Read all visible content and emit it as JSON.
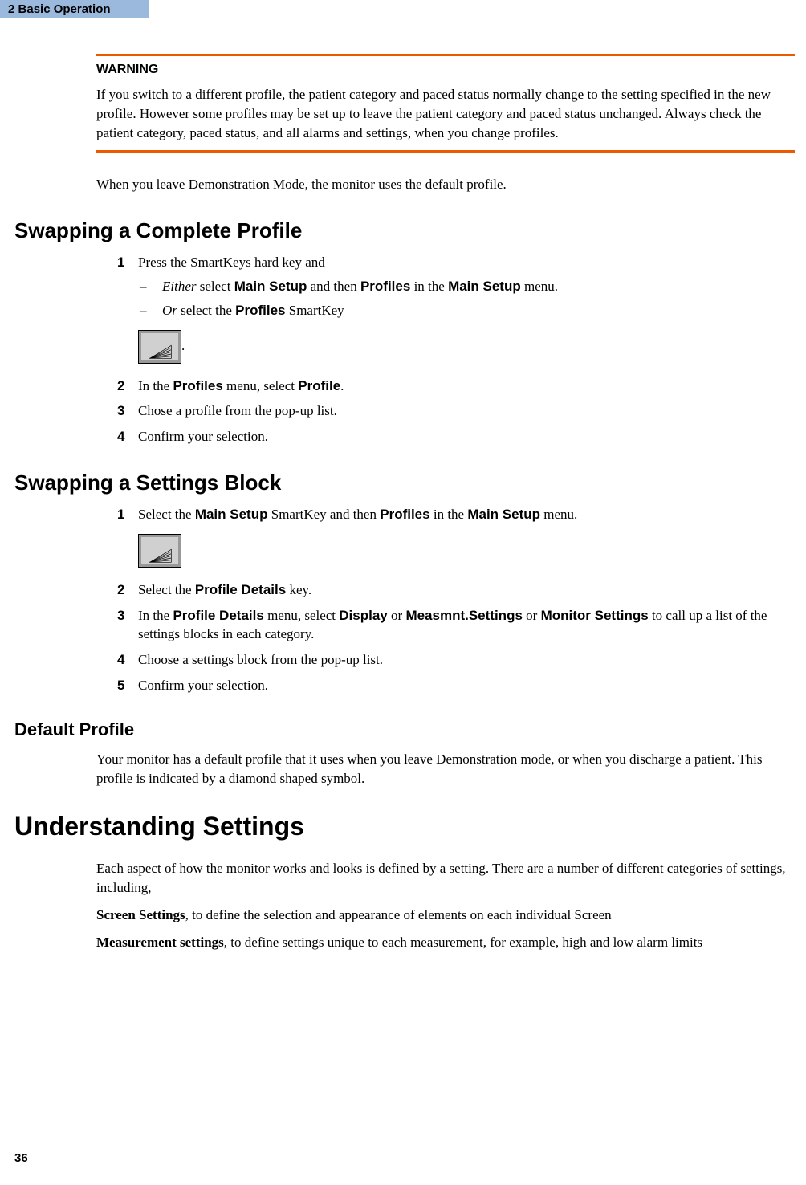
{
  "header": {
    "chapter_number": "2",
    "chapter_title": "Basic Operation"
  },
  "warning": {
    "label": "WARNING",
    "text": "If you switch to a different profile, the patient category and paced status normally change to the setting specified in the new profile. However some profiles may be set up to leave the patient category and paced status unchanged. Always check the patient category, paced status, and all alarms and settings, when you change profiles."
  },
  "demo_text": "When you leave Demonstration Mode, the monitor uses the default profile.",
  "swap_complete": {
    "title": "Swapping a Complete Profile",
    "step1_intro": "Press the SmartKeys hard key and",
    "step1_either_pre": "Either",
    "step1_either_1": " select ",
    "step1_either_ui1": "Main Setup",
    "step1_either_2": " and then ",
    "step1_either_ui2": "Profiles",
    "step1_either_3": " in the ",
    "step1_either_ui3": "Main Setup",
    "step1_either_4": " menu.",
    "step1_or_pre": "Or",
    "step1_or_1": " select the ",
    "step1_or_ui1": "Profiles",
    "step1_or_2": " SmartKey",
    "step1_period": ".",
    "step2_1": "In the ",
    "step2_ui1": "Profiles",
    "step2_2": " menu, select ",
    "step2_ui2": "Profile",
    "step2_3": ".",
    "step3": "Chose a profile from the pop-up list.",
    "step4": "Confirm your selection."
  },
  "swap_block": {
    "title": "Swapping a Settings Block",
    "step1_1": "Select the ",
    "step1_ui1": "Main Setup",
    "step1_2": " SmartKey and then ",
    "step1_ui2": "Profiles",
    "step1_3": " in the ",
    "step1_ui3": "Main Setup",
    "step1_4": " menu.",
    "step2_1": "Select the ",
    "step2_ui1": "Profile Details",
    "step2_2": " key.",
    "step3_1": "In the ",
    "step3_ui1": "Profile Details",
    "step3_2": " menu, select ",
    "step3_ui2": "Display",
    "step3_3": " or ",
    "step3_ui3": "Measmnt.Settings",
    "step3_4": " or ",
    "step3_ui4": "Monitor Settings",
    "step3_5": " to call up a list of the settings blocks in each category.",
    "step4": "Choose a settings block from the pop-up list.",
    "step5": "Confirm your selection."
  },
  "default_profile": {
    "title": "Default Profile",
    "text": "Your monitor has a default profile that it uses when you leave Demonstration mode, or when you discharge a patient. This profile is indicated by a diamond shaped symbol."
  },
  "understanding": {
    "title": "Understanding Settings",
    "intro": "Each aspect of how the monitor works and looks is defined by a setting. There are a number of different categories of settings, including,",
    "screen_label": "Screen Settings",
    "screen_text": ", to define the selection and appearance of elements on each individual Screen",
    "measurement_label": "Measurement settings",
    "measurement_text": ", to define settings unique to each measurement, for example, high and low alarm limits"
  },
  "page_number": "36",
  "numbers": {
    "n1": "1",
    "n2": "2",
    "n3": "3",
    "n4": "4",
    "n5": "5"
  },
  "dash": "–"
}
